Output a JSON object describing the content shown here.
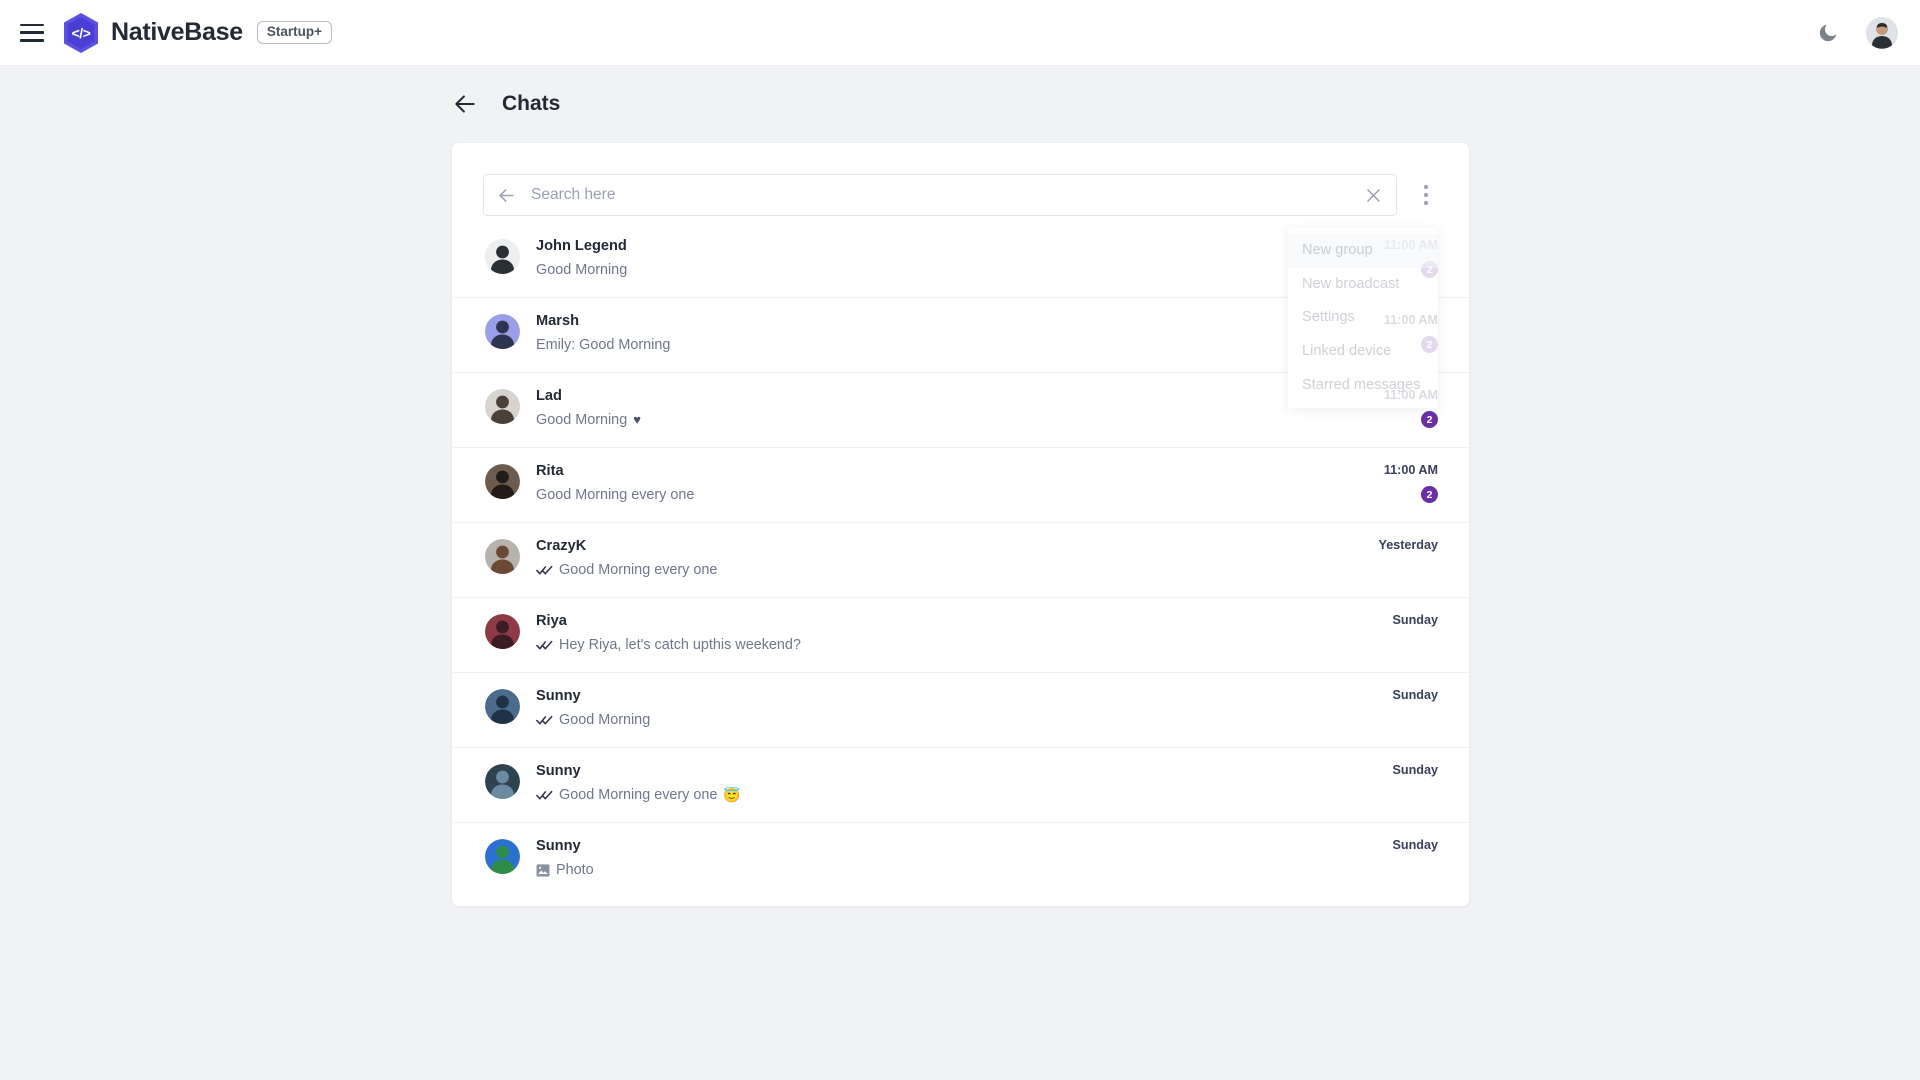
{
  "appbar": {
    "menu_icon": "hamburger-icon",
    "logo_glyph": "</>",
    "brand": "NativeBase",
    "plan_badge": "Startup+",
    "theme_toggle_icon": "moon-icon",
    "avatar_icon": "user-avatar",
    "logo_color": "#5b50e0",
    "brand_color": "#232a35"
  },
  "page": {
    "back_icon": "arrow-left-icon",
    "title": "Chats"
  },
  "search": {
    "back_icon": "arrow-left-icon",
    "placeholder": "Search here",
    "value": "",
    "clear_icon": "close-icon",
    "menu_icon": "dots-vertical-icon"
  },
  "dropdown": {
    "visible": true,
    "items": [
      {
        "label": "New group",
        "hovered": true
      },
      {
        "label": "New broadcast",
        "hovered": false
      },
      {
        "label": "Settings",
        "hovered": false
      },
      {
        "label": "Linked device",
        "hovered": false
      },
      {
        "label": "Starred messages",
        "hovered": false
      }
    ]
  },
  "colors": {
    "page_bg": "#f1f2f4",
    "card_bg": "#ffffff",
    "badge_purple": "#6a2fa6",
    "name_text": "#232a35",
    "message_text": "#70778a",
    "divider": "#f0f1f3"
  },
  "chats": [
    {
      "name": "John Legend",
      "message": "Good Morning",
      "prefix_icon": "",
      "suffix": "",
      "time": "11:00 AM",
      "unread": "2",
      "avatar_colors": [
        "#eceef0",
        "#2b2f36"
      ]
    },
    {
      "name": "Marsh",
      "message": "Emily: Good Morning",
      "prefix_icon": "",
      "suffix": "",
      "time": "11:00 AM",
      "unread": "2",
      "avatar_colors": [
        "#9a9ee6",
        "#2c3550"
      ]
    },
    {
      "name": "Lad",
      "message": "Good Morning",
      "prefix_icon": "",
      "suffix": "♥",
      "time": "11:00 AM",
      "unread": "2",
      "avatar_colors": [
        "#d7d4cf",
        "#4a4038"
      ]
    },
    {
      "name": "Rita",
      "message": "Good Morning every one",
      "prefix_icon": "",
      "suffix": "",
      "time": "11:00 AM",
      "unread": "2",
      "avatar_colors": [
        "#6d5c4e",
        "#231c16"
      ]
    },
    {
      "name": "CrazyK",
      "message": "Good Morning every one",
      "prefix_icon": "double-check-icon",
      "suffix": "",
      "time": "Yesterday",
      "unread": "",
      "avatar_colors": [
        "#b6b2ad",
        "#6a4a33"
      ]
    },
    {
      "name": "Riya",
      "message": "Hey Riya, let's catch upthis weekend?",
      "prefix_icon": "double-check-icon",
      "suffix": "",
      "time": "Sunday",
      "unread": "",
      "avatar_colors": [
        "#8e3a46",
        "#3b1c22"
      ]
    },
    {
      "name": "Sunny",
      "message": "Good Morning",
      "prefix_icon": "double-check-icon",
      "suffix": "",
      "time": "Sunday",
      "unread": "",
      "avatar_colors": [
        "#4a6b8a",
        "#1f3347"
      ]
    },
    {
      "name": "Sunny",
      "message": "Good Morning every one",
      "prefix_icon": "double-check-icon",
      "suffix": "😇",
      "time": "Sunday",
      "unread": "",
      "avatar_colors": [
        "#2e4250",
        "#6d8ba0"
      ]
    },
    {
      "name": "Sunny",
      "message": "Photo",
      "prefix_icon": "image-icon",
      "suffix": "",
      "time": "Sunday",
      "unread": "",
      "avatar_colors": [
        "#2b6fd0",
        "#2e8b4a"
      ]
    }
  ]
}
